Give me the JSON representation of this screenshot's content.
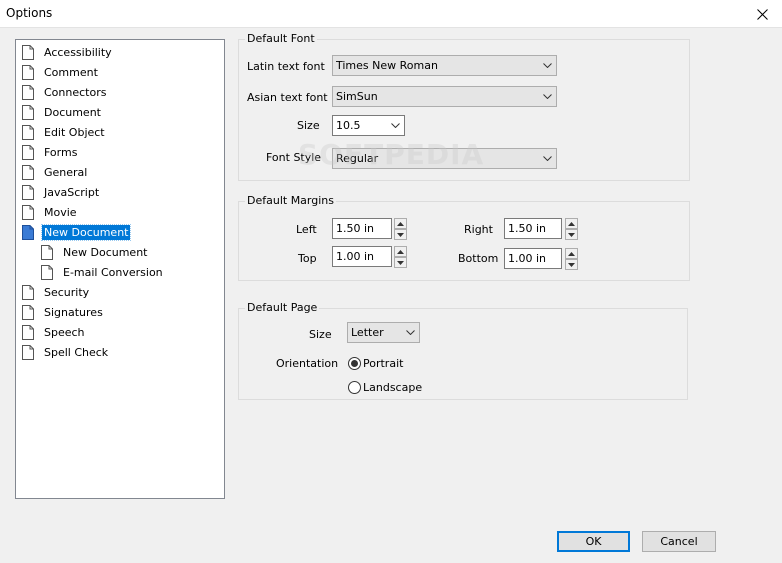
{
  "window": {
    "title": "Options"
  },
  "tree": {
    "items": [
      {
        "label": "Accessibility"
      },
      {
        "label": "Comment"
      },
      {
        "label": "Connectors"
      },
      {
        "label": "Document"
      },
      {
        "label": "Edit Object"
      },
      {
        "label": "Forms"
      },
      {
        "label": "General"
      },
      {
        "label": "JavaScript"
      },
      {
        "label": "Movie"
      },
      {
        "label": "New Document",
        "selected": true
      },
      {
        "label": "New Document",
        "child": true
      },
      {
        "label": "E-mail Conversion",
        "child": true
      },
      {
        "label": "Security"
      },
      {
        "label": "Signatures"
      },
      {
        "label": "Speech"
      },
      {
        "label": "Spell Check"
      }
    ]
  },
  "default_font": {
    "title": "Default Font",
    "latin_label": "Latin text font",
    "latin_value": "Times New Roman",
    "asian_label": "Asian text font",
    "asian_value": "SimSun",
    "size_label": "Size",
    "size_value": "10.5",
    "style_label": "Font Style",
    "style_value": "Regular"
  },
  "default_margins": {
    "title": "Default Margins",
    "left_label": "Left",
    "left_value": "1.50 in",
    "right_label": "Right",
    "right_value": "1.50 in",
    "top_label": "Top",
    "top_value": "1.00 in",
    "bottom_label": "Bottom",
    "bottom_value": "1.00 in"
  },
  "default_page": {
    "title": "Default Page",
    "size_label": "Size",
    "size_value": "Letter",
    "orientation_label": "Orientation",
    "portrait_label": "Portrait",
    "landscape_label": "Landscape",
    "orientation_selected": "Portrait"
  },
  "buttons": {
    "ok": "OK",
    "cancel": "Cancel"
  },
  "watermark": "SOFTPEDIA",
  "colors": {
    "selection": "#0078d7",
    "default_button_border": "#0078d7"
  }
}
